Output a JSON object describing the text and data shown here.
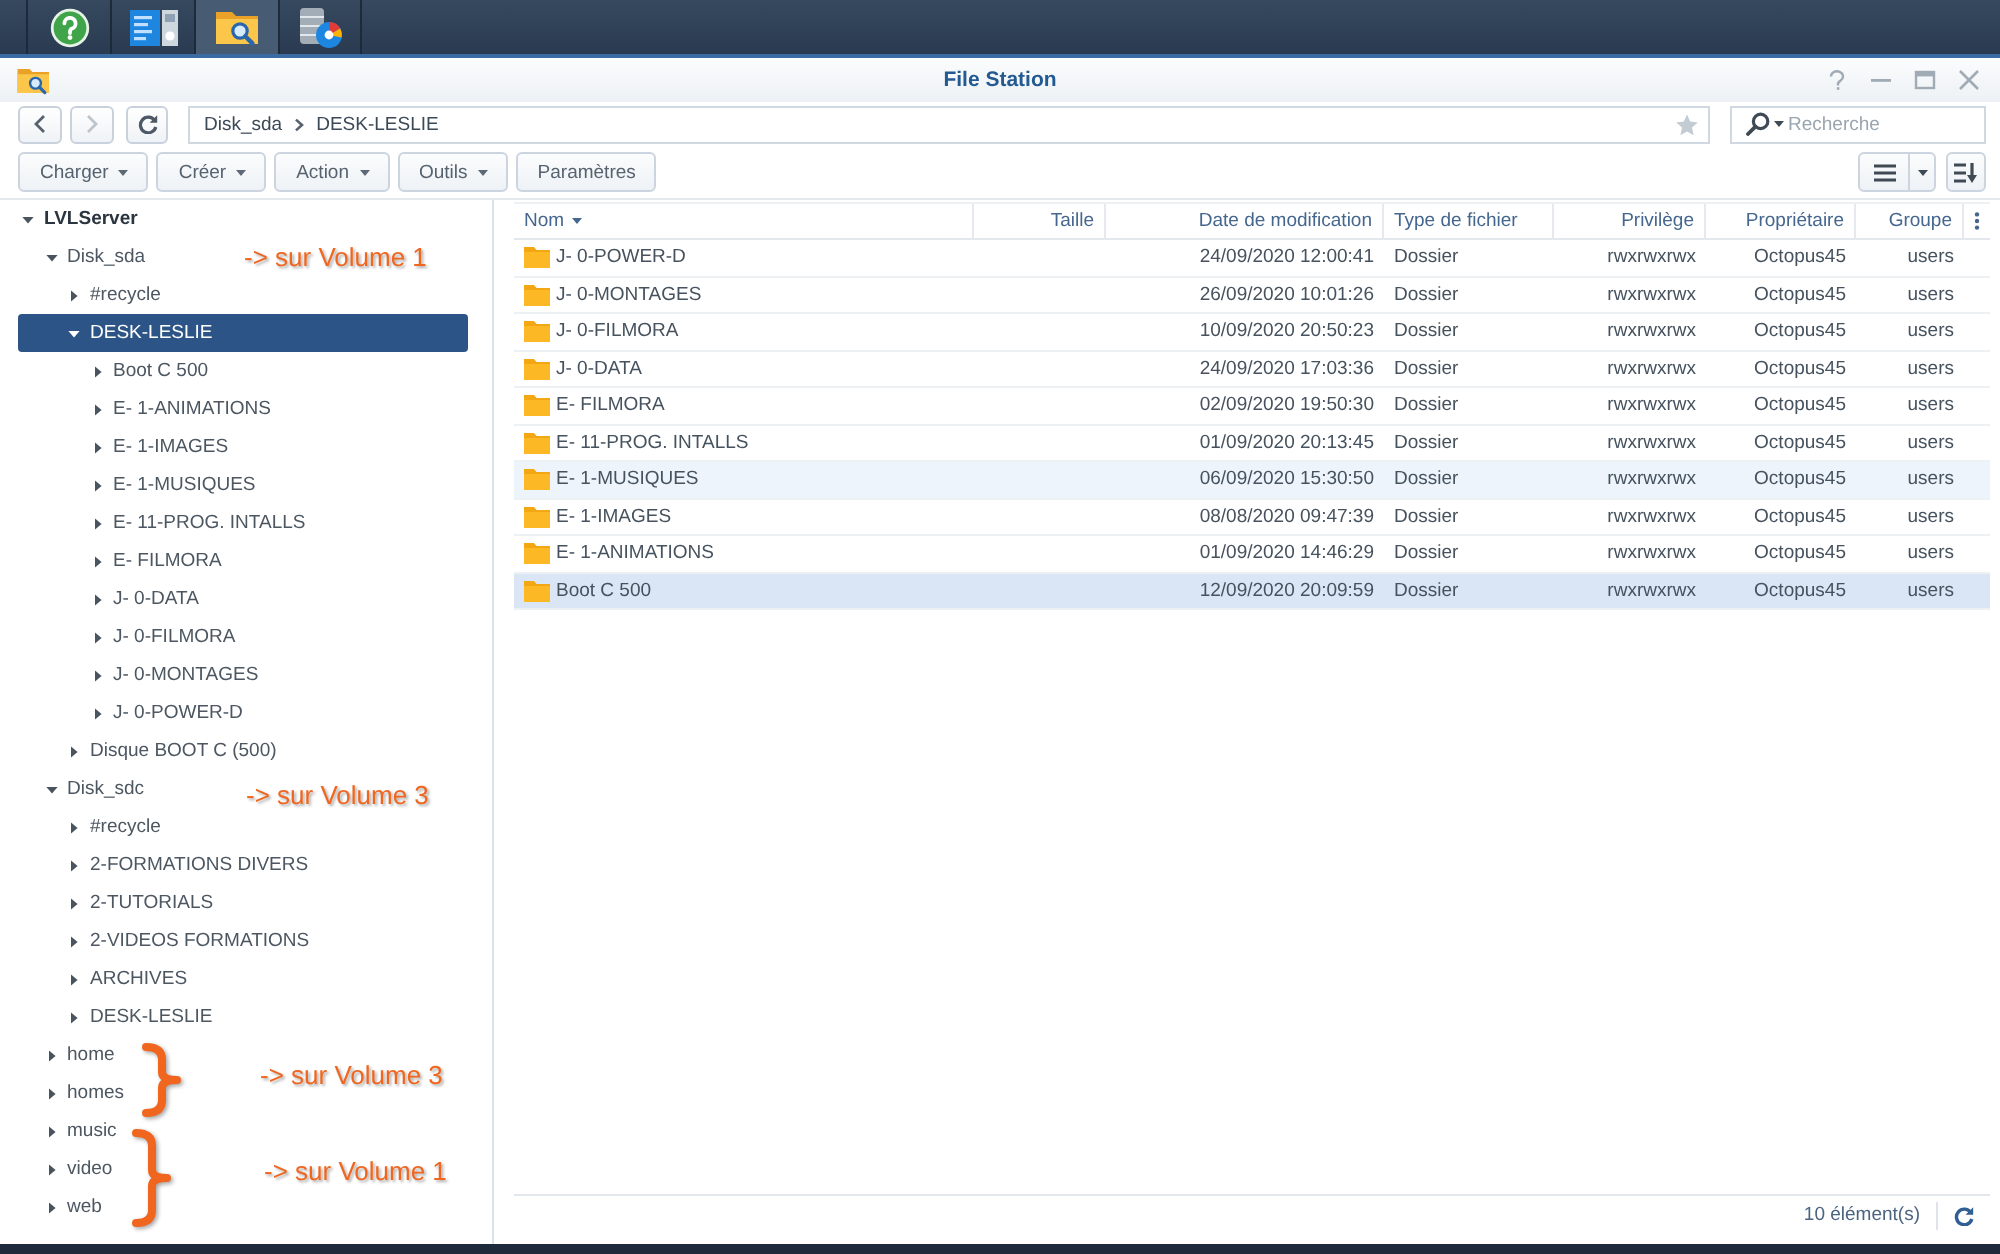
{
  "taskbar": {
    "apps": [
      {
        "kind": "help",
        "selected": false
      },
      {
        "kind": "panel",
        "selected": false
      },
      {
        "kind": "files",
        "selected": true
      },
      {
        "kind": "storage",
        "selected": false
      }
    ]
  },
  "window": {
    "title": "File Station"
  },
  "navigation": {
    "back": {
      "disabled": false
    },
    "forward": {
      "disabled": true
    },
    "path": [
      "Disk_sda",
      "DESK-LESLIE"
    ],
    "search": {
      "placeholder": "Recherche"
    }
  },
  "actions": [
    {
      "label": "Charger",
      "menu": true
    },
    {
      "label": "Créer",
      "menu": true
    },
    {
      "label": "Action",
      "menu": true
    },
    {
      "label": "Outils",
      "menu": true
    },
    {
      "label": "Paramètres",
      "menu": false
    }
  ],
  "tree": [
    {
      "label": "LVLServer",
      "expanded": true,
      "selected": false,
      "children": [
        {
          "label": "Disk_sda",
          "expanded": true,
          "selected": false,
          "children": [
            {
              "label": "#recycle",
              "expanded": false,
              "selected": false
            },
            {
              "label": "DESK-LESLIE",
              "expanded": true,
              "selected": true,
              "children": [
                {
                  "label": "Boot C 500",
                  "expanded": false,
                  "selected": false
                },
                {
                  "label": "E- 1-ANIMATIONS",
                  "expanded": false,
                  "selected": false
                },
                {
                  "label": "E- 1-IMAGES",
                  "expanded": false,
                  "selected": false
                },
                {
                  "label": "E- 1-MUSIQUES",
                  "expanded": false,
                  "selected": false
                },
                {
                  "label": "E- 11-PROG. INTALLS",
                  "expanded": false,
                  "selected": false
                },
                {
                  "label": "E- FILMORA",
                  "expanded": false,
                  "selected": false
                },
                {
                  "label": "J- 0-DATA",
                  "expanded": false,
                  "selected": false
                },
                {
                  "label": "J- 0-FILMORA",
                  "expanded": false,
                  "selected": false
                },
                {
                  "label": "J- 0-MONTAGES",
                  "expanded": false,
                  "selected": false
                },
                {
                  "label": "J- 0-POWER-D",
                  "expanded": false,
                  "selected": false
                }
              ]
            },
            {
              "label": "Disque BOOT C (500)",
              "expanded": false,
              "selected": false
            }
          ]
        },
        {
          "label": "Disk_sdc",
          "expanded": true,
          "selected": false,
          "children": [
            {
              "label": "#recycle",
              "expanded": false,
              "selected": false
            },
            {
              "label": "2-FORMATIONS DIVERS",
              "expanded": false,
              "selected": false
            },
            {
              "label": "2-TUTORIALS",
              "expanded": false,
              "selected": false
            },
            {
              "label": "2-VIDEOS FORMATIONS",
              "expanded": false,
              "selected": false
            },
            {
              "label": "ARCHIVES",
              "expanded": false,
              "selected": false
            },
            {
              "label": "DESK-LESLIE",
              "expanded": false,
              "selected": false
            }
          ]
        },
        {
          "label": "home",
          "expanded": false,
          "selected": false
        },
        {
          "label": "homes",
          "expanded": false,
          "selected": false
        },
        {
          "label": "music",
          "expanded": false,
          "selected": false
        },
        {
          "label": "video",
          "expanded": false,
          "selected": false
        },
        {
          "label": "web",
          "expanded": false,
          "selected": false
        }
      ]
    }
  ],
  "annotations": [
    {
      "kind": "note",
      "text": "-> sur Volume 1"
    },
    {
      "kind": "note",
      "text": "-> sur Volume 3"
    },
    {
      "kind": "brace",
      "text": "-> sur Volume 3"
    },
    {
      "kind": "brace",
      "text": "-> sur Volume 1"
    }
  ],
  "table": {
    "columns": [
      {
        "label": "Nom",
        "sorted": true
      },
      {
        "label": "Taille",
        "sorted": false
      },
      {
        "label": "Date de modification",
        "sorted": false
      },
      {
        "label": "Type de fichier",
        "sorted": false
      },
      {
        "label": "Privilège",
        "sorted": false
      },
      {
        "label": "Propriétaire",
        "sorted": false
      },
      {
        "label": "Groupe",
        "sorted": false
      }
    ],
    "rows": [
      {
        "name": "J- 0-POWER-D",
        "modified": "24/09/2020 12:00:41",
        "type": "Dossier",
        "privilege": "rwxrwxrwx",
        "owner": "Octopus45",
        "group": "users",
        "selected": false,
        "hovered": false
      },
      {
        "name": "J- 0-MONTAGES",
        "modified": "26/09/2020 10:01:26",
        "type": "Dossier",
        "privilege": "rwxrwxrwx",
        "owner": "Octopus45",
        "group": "users",
        "selected": false,
        "hovered": false
      },
      {
        "name": "J- 0-FILMORA",
        "modified": "10/09/2020 20:50:23",
        "type": "Dossier",
        "privilege": "rwxrwxrwx",
        "owner": "Octopus45",
        "group": "users",
        "selected": false,
        "hovered": false
      },
      {
        "name": "J- 0-DATA",
        "modified": "24/09/2020 17:03:36",
        "type": "Dossier",
        "privilege": "rwxrwxrwx",
        "owner": "Octopus45",
        "group": "users",
        "selected": false,
        "hovered": false
      },
      {
        "name": "E- FILMORA",
        "modified": "02/09/2020 19:50:30",
        "type": "Dossier",
        "privilege": "rwxrwxrwx",
        "owner": "Octopus45",
        "group": "users",
        "selected": false,
        "hovered": false
      },
      {
        "name": "E- 11-PROG. INTALLS",
        "modified": "01/09/2020 20:13:45",
        "type": "Dossier",
        "privilege": "rwxrwxrwx",
        "owner": "Octopus45",
        "group": "users",
        "selected": false,
        "hovered": false
      },
      {
        "name": "E- 1-MUSIQUES",
        "modified": "06/09/2020 15:30:50",
        "type": "Dossier",
        "privilege": "rwxrwxrwx",
        "owner": "Octopus45",
        "group": "users",
        "selected": false,
        "hovered": true
      },
      {
        "name": "E- 1-IMAGES",
        "modified": "08/08/2020 09:47:39",
        "type": "Dossier",
        "privilege": "rwxrwxrwx",
        "owner": "Octopus45",
        "group": "users",
        "selected": false,
        "hovered": false
      },
      {
        "name": "E- 1-ANIMATIONS",
        "modified": "01/09/2020 14:46:29",
        "type": "Dossier",
        "privilege": "rwxrwxrwx",
        "owner": "Octopus45",
        "group": "users",
        "selected": false,
        "hovered": false
      },
      {
        "name": "Boot C 500",
        "modified": "12/09/2020 20:09:59",
        "type": "Dossier",
        "privilege": "rwxrwxrwx",
        "owner": "Octopus45",
        "group": "users",
        "selected": true,
        "hovered": false
      }
    ]
  },
  "status_bar": {
    "count": "10 élément(s)"
  }
}
